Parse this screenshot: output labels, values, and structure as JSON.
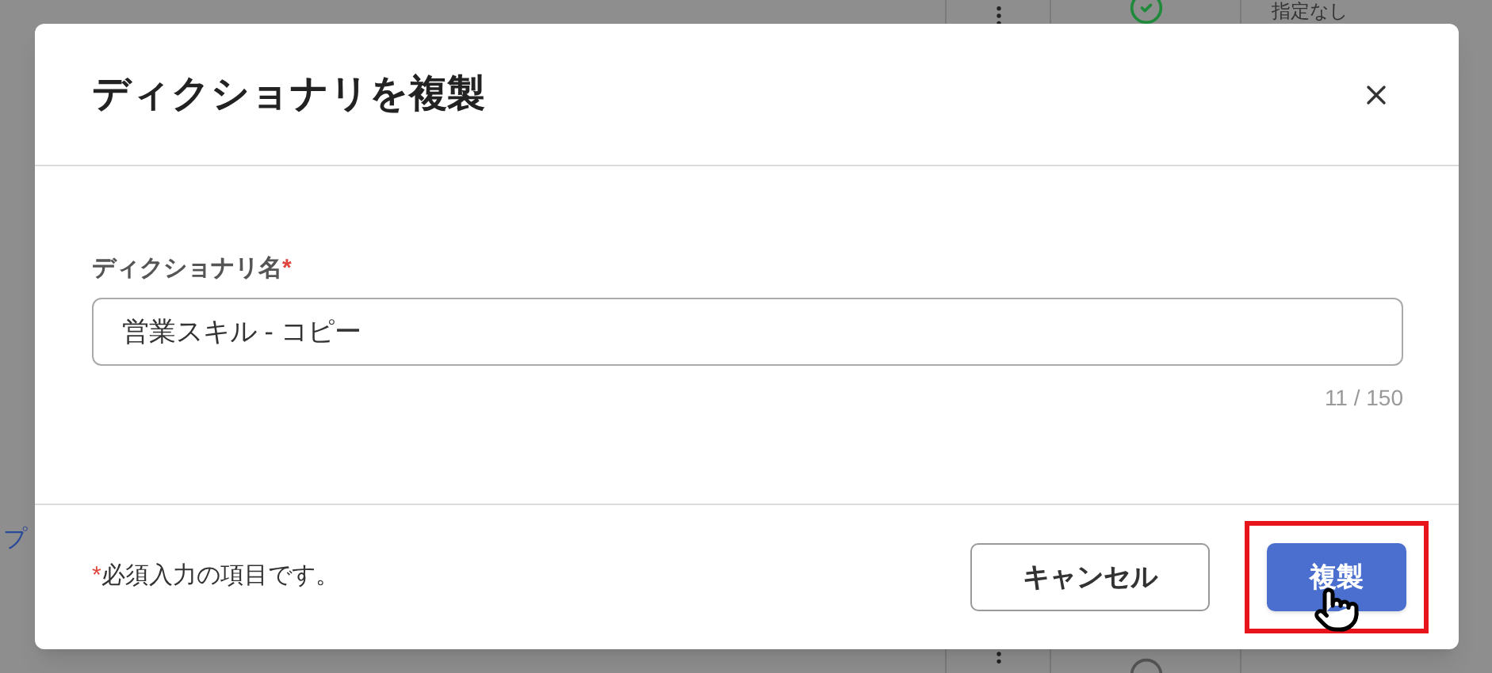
{
  "background": {
    "top_row": {
      "column_4": "指定なし"
    },
    "left_link": "プ"
  },
  "dialog": {
    "title": "ディクショナリを複製",
    "field": {
      "label": "ディクショナリ名",
      "required_mark": "*",
      "value": "営業スキル - コピー",
      "counter": "11 / 150"
    },
    "footer_note": {
      "mark": "*",
      "text": "必須入力の項目です。"
    },
    "buttons": [
      {
        "label": "キャンセル",
        "kind": "secondary",
        "highlighted": false
      },
      {
        "label": "複製",
        "kind": "primary",
        "highlighted": true
      }
    ]
  }
}
